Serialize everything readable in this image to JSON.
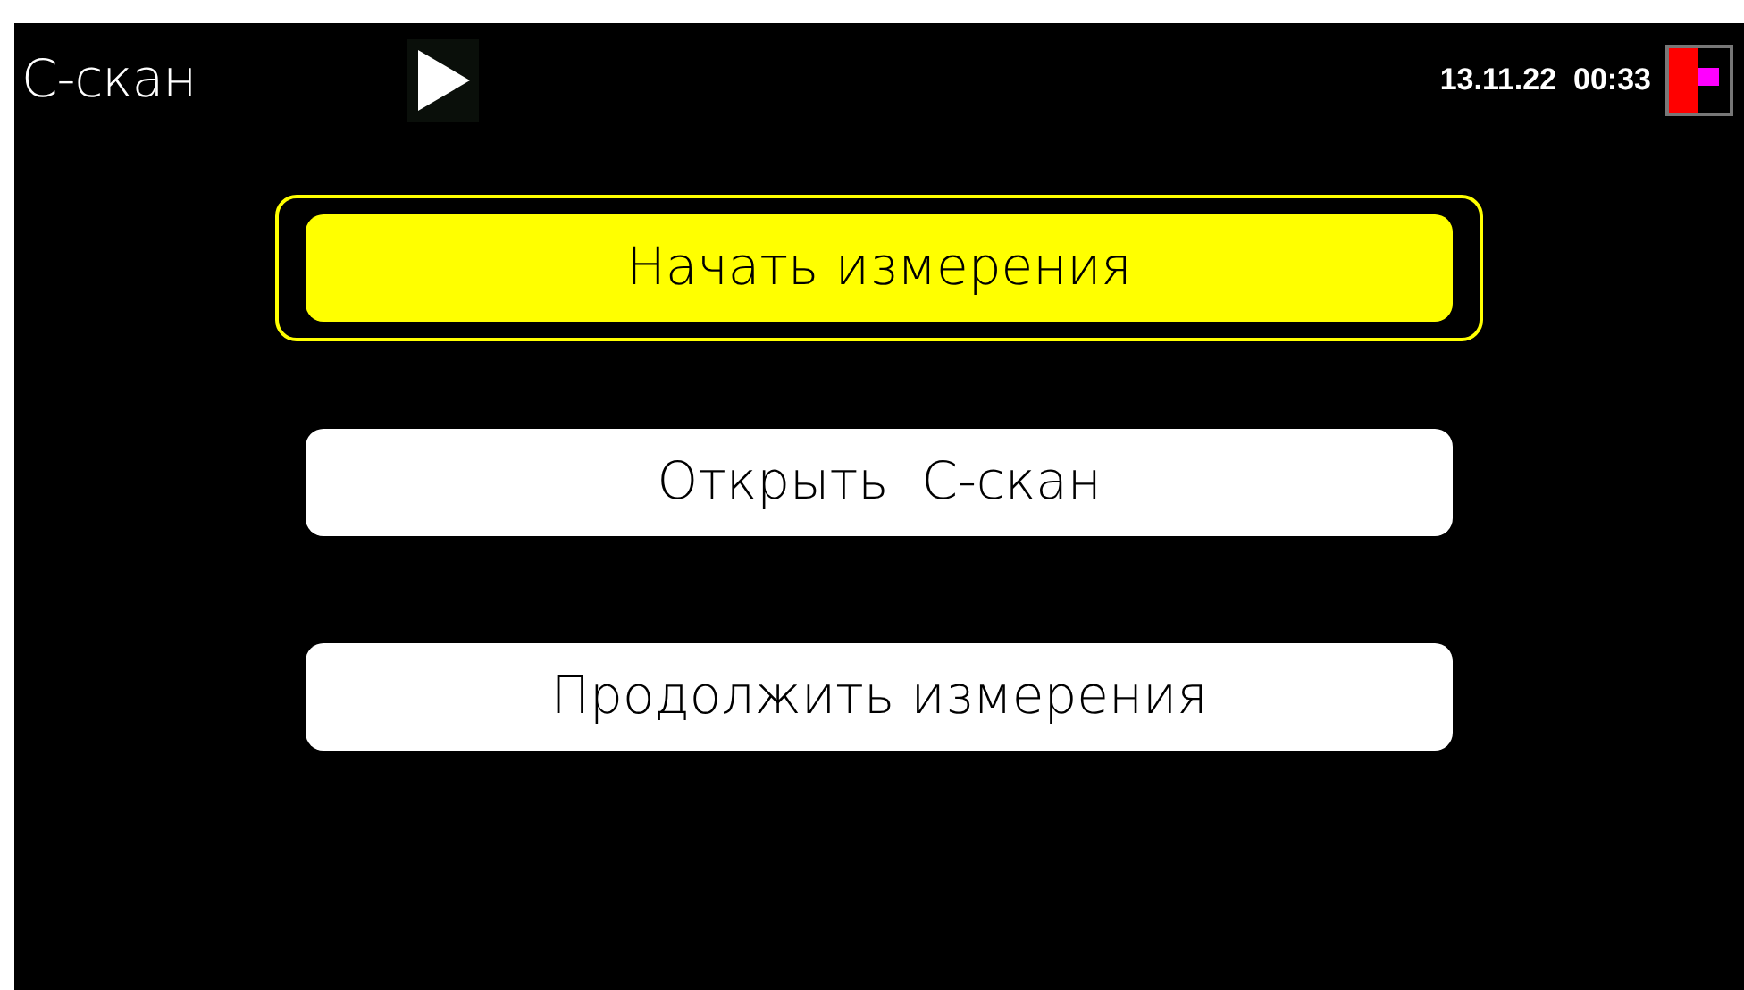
{
  "header": {
    "title": "С-скан",
    "datetime": "13.11.22  00:33"
  },
  "buttons": [
    {
      "label": "Начать измерения",
      "selected": true
    },
    {
      "label": "Открыть  С-скан",
      "selected": false
    },
    {
      "label": "Продолжить измерения",
      "selected": false
    }
  ]
}
